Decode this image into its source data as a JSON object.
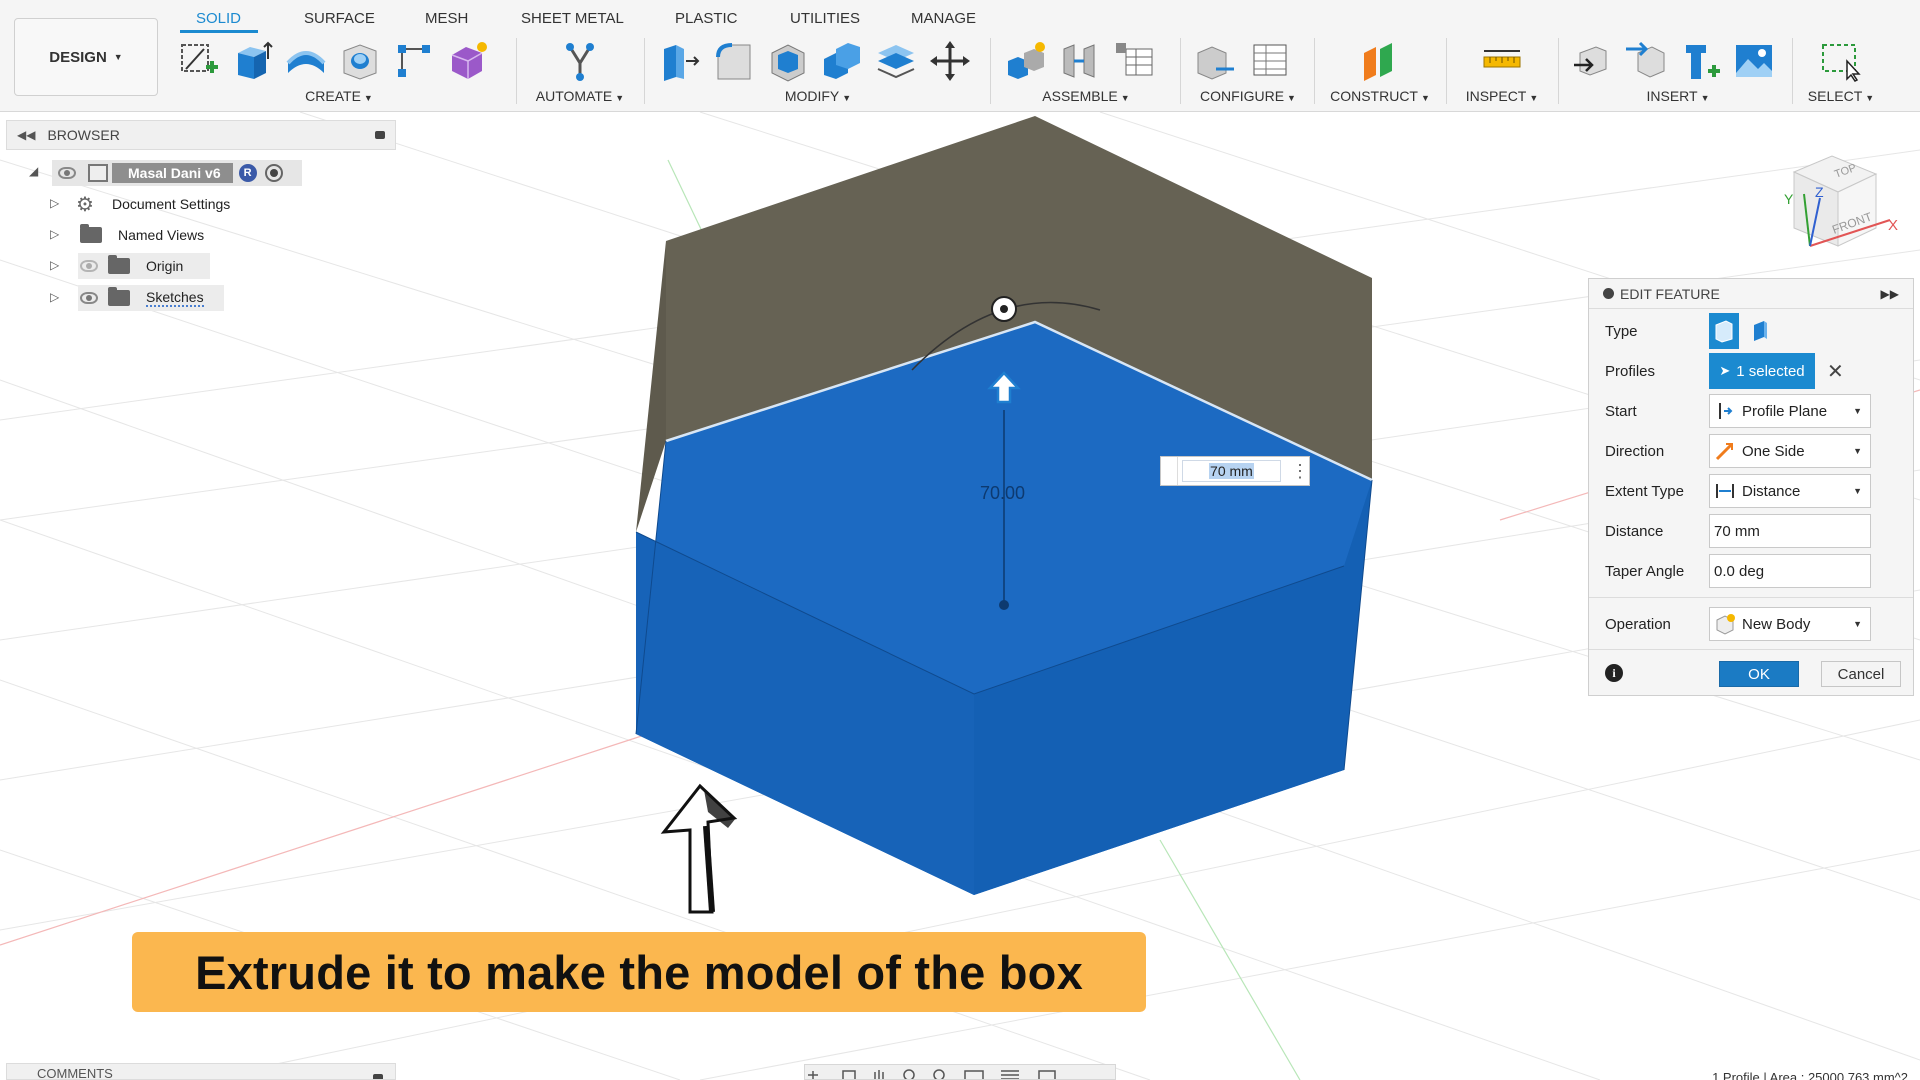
{
  "workspace": {
    "label": "DESIGN"
  },
  "tabs": [
    {
      "label": "SOLID",
      "active": true
    },
    {
      "label": "SURFACE"
    },
    {
      "label": "MESH"
    },
    {
      "label": "SHEET METAL"
    },
    {
      "label": "PLASTIC"
    },
    {
      "label": "UTILITIES"
    },
    {
      "label": "MANAGE"
    }
  ],
  "groups": {
    "create": "CREATE",
    "automate": "AUTOMATE",
    "modify": "MODIFY",
    "assemble": "ASSEMBLE",
    "configure": "CONFIGURE",
    "construct": "CONSTRUCT",
    "inspect": "INSPECT",
    "insert": "INSERT",
    "select": "SELECT"
  },
  "browser": {
    "title": "BROWSER",
    "root": "Masal Dani v6",
    "root_badge": "R",
    "items": [
      {
        "label": "Document Settings",
        "icon": "gear-icon"
      },
      {
        "label": "Named Views",
        "icon": "folder-icon"
      },
      {
        "label": "Origin",
        "icon": "folder-icon"
      },
      {
        "label": "Sketches",
        "icon": "folder-icon"
      }
    ]
  },
  "edit_feature": {
    "title": "EDIT FEATURE",
    "rows": {
      "type": "Type",
      "profiles": "Profiles",
      "start": "Start",
      "direction": "Direction",
      "extent_type": "Extent Type",
      "distance": "Distance",
      "taper_angle": "Taper Angle",
      "operation": "Operation"
    },
    "values": {
      "profiles": "1 selected",
      "start": "Profile Plane",
      "direction": "One Side",
      "extent_type": "Distance",
      "distance": "70 mm",
      "taper_angle": "0.0 deg",
      "operation": "New Body"
    },
    "ok": "OK",
    "cancel": "Cancel"
  },
  "viewport": {
    "distance_input": "70 mm",
    "dimension_label": "70.00",
    "viewcube": {
      "top": "TOP",
      "front": "FRONT",
      "x": "X",
      "y": "Y",
      "z": "Z"
    }
  },
  "caption": "Extrude it to make the model of the box",
  "bottom": {
    "comments": "COMMENTS",
    "status": "1 Profile | Area : 25000.763 mm^2"
  },
  "colors": {
    "accent": "#1b8ad0",
    "extrude_blue": "#1565c0",
    "sketch_body": "#6b6558",
    "caption_bg": "#fbb74f"
  }
}
